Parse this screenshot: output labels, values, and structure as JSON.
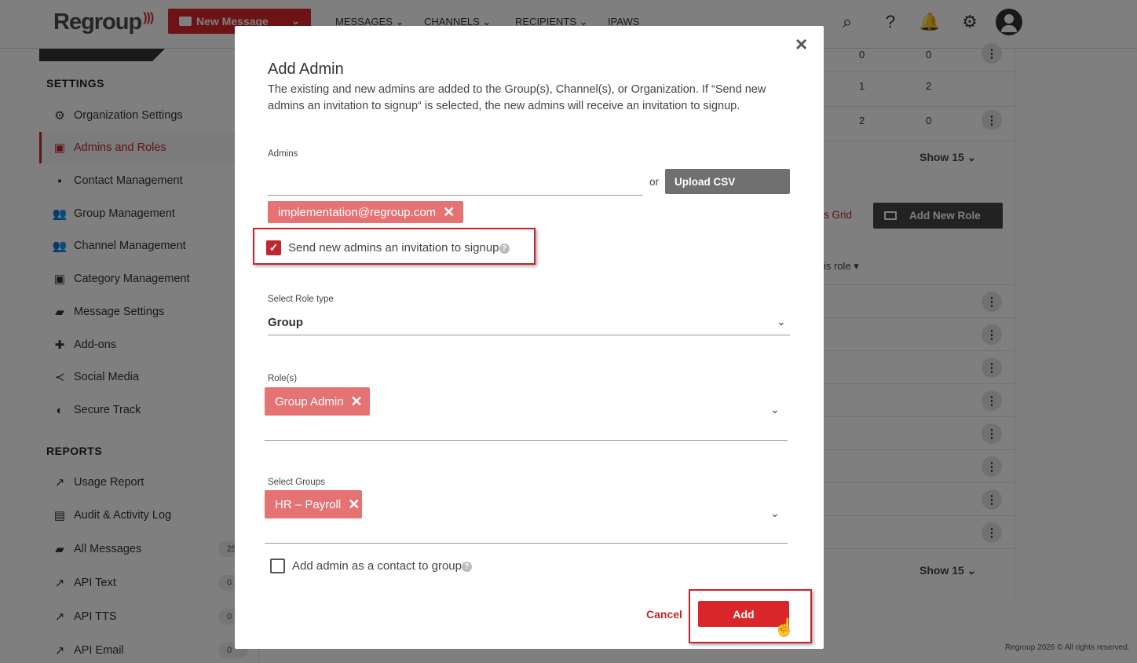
{
  "header": {
    "logo": "Regroup",
    "new_message": "New Message",
    "nav": [
      "MESSAGES",
      "CHANNELS",
      "RECIPIENTS",
      "IPAWS"
    ]
  },
  "sidebar": {
    "settings_heading": "SETTINGS",
    "settings_items": [
      {
        "label": "Organization Settings",
        "icon": "gear-icon"
      },
      {
        "label": "Admins and Roles",
        "icon": "admin-card-icon"
      },
      {
        "label": "Contact Management",
        "icon": "contact-card-icon"
      },
      {
        "label": "Group Management",
        "icon": "group-add-icon"
      },
      {
        "label": "Channel Management",
        "icon": "group-add-icon"
      },
      {
        "label": "Category Management",
        "icon": "category-search-icon"
      },
      {
        "label": "Message Settings",
        "icon": "chat-icon"
      },
      {
        "label": "Add-ons",
        "icon": "puzzle-icon"
      },
      {
        "label": "Social Media",
        "icon": "share-icon"
      },
      {
        "label": "Secure Track",
        "icon": "shield-icon"
      }
    ],
    "reports_heading": "REPORTS",
    "report_items": [
      {
        "label": "Usage Report",
        "icon": "trend-icon",
        "badge": ""
      },
      {
        "label": "Audit & Activity Log",
        "icon": "log-icon",
        "badge": ""
      },
      {
        "label": "All Messages",
        "icon": "chat-icon",
        "badge": "25"
      },
      {
        "label": "API Text",
        "icon": "arrow-up-right-icon",
        "badge": "0"
      },
      {
        "label": "API TTS",
        "icon": "arrow-up-right-icon",
        "badge": "0"
      },
      {
        "label": "API Email",
        "icon": "arrow-up-right-icon",
        "badge": "0"
      }
    ]
  },
  "background": {
    "rows": [
      [
        "0",
        "0"
      ],
      [
        "1",
        "2"
      ],
      [
        "2",
        "0"
      ]
    ],
    "show_label": "Show 15",
    "grid_link": "s Grid",
    "add_role": "Add New Role",
    "role_header": "is role"
  },
  "modal": {
    "title": "Add Admin",
    "description": "The existing and new admins are added to the Group(s), Channel(s), or Organization. If “Send new admins an invitation to signup“ is selected, the new admins will receive an invitation to signup.",
    "admins_label": "Admins",
    "admins_value": "",
    "or": "or",
    "upload_csv": "Upload CSV",
    "admin_chip": "implementation@regroup.com",
    "invite_label": "Send new admins an invitation to signup",
    "invite_checked": true,
    "role_type_label": "Select Role type",
    "role_type_value": "Group",
    "roles_label": "Role(s)",
    "role_chip": "Group Admin",
    "groups_label": "Select Groups",
    "group_chip": "HR – Payroll",
    "contact_label": "Add admin as a contact to group",
    "contact_checked": false,
    "cancel": "Cancel",
    "add": "Add"
  },
  "footer": "Regroup 2026 © All rights reserved.",
  "colors": {
    "brand": "#d9262b",
    "chip": "#e57373",
    "highlight": "#c0262b"
  }
}
